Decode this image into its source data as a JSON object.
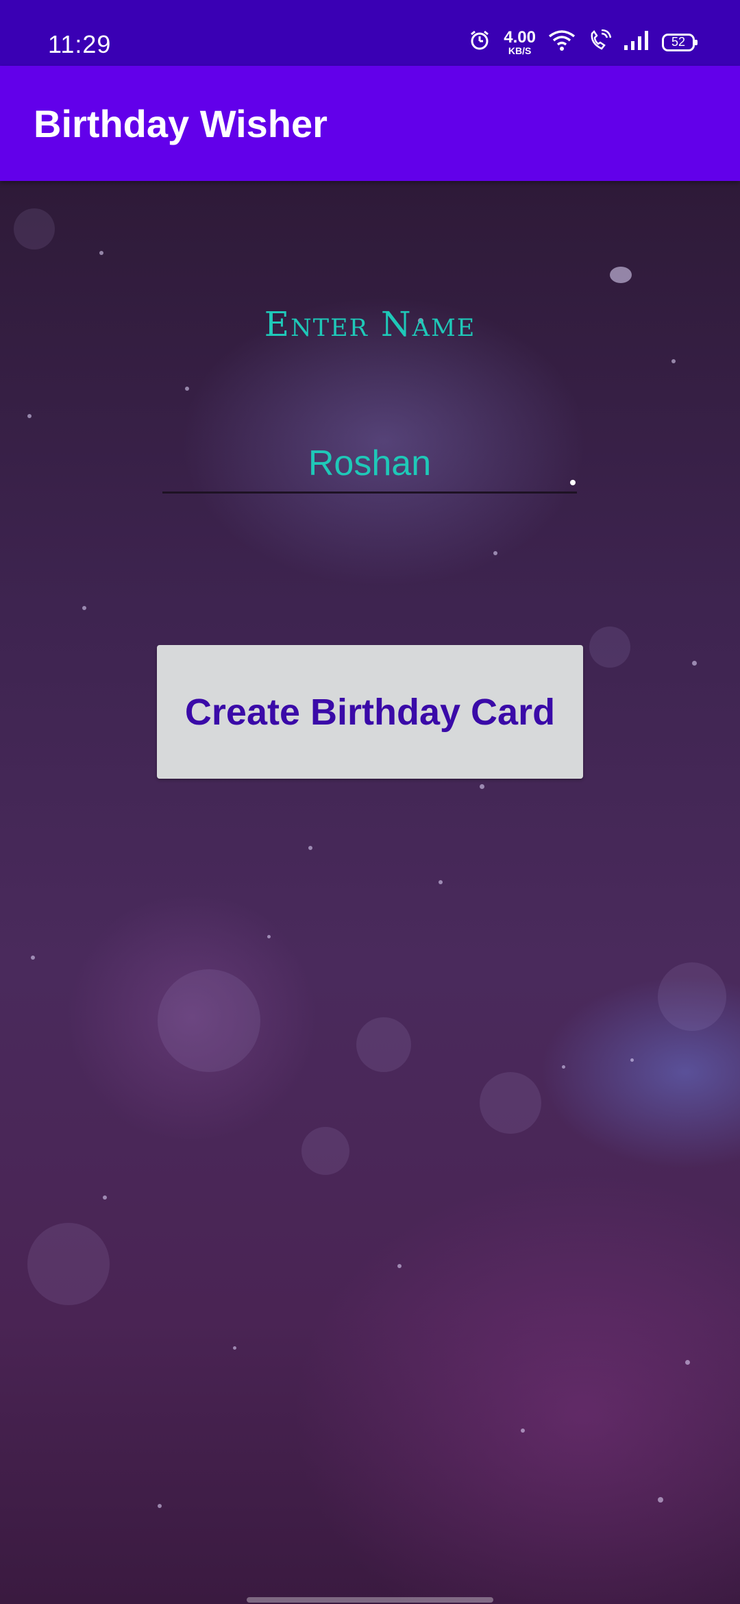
{
  "status_bar": {
    "time": "11:29",
    "net_speed_value": "4.00",
    "net_speed_unit": "KB/S",
    "battery_level": "52",
    "icons": [
      "alarm-icon",
      "wifi-icon",
      "wifi-calling-icon",
      "cell-signal-icon",
      "battery-icon"
    ]
  },
  "app_bar": {
    "title": "Birthday Wisher",
    "color": "#6200ea"
  },
  "form": {
    "label": "Enter Name",
    "name_value": "Roshan",
    "button_label": "Create Birthday Card"
  },
  "colors": {
    "status_bar": "#3a00b4",
    "accent_text": "#1fc8b8",
    "button_bg": "#d7d9da",
    "button_text": "#3a0aa8"
  }
}
